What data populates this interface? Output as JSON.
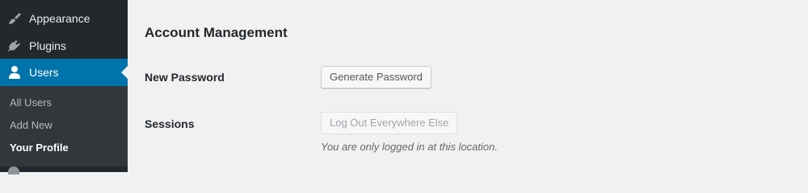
{
  "sidebar": {
    "items": [
      {
        "label": "Appearance",
        "icon": "paintbrush-icon"
      },
      {
        "label": "Plugins",
        "icon": "plugin-icon"
      },
      {
        "label": "Users",
        "icon": "user-icon",
        "active": true
      }
    ],
    "submenu": [
      {
        "label": "All Users"
      },
      {
        "label": "Add New"
      },
      {
        "label": "Your Profile",
        "current": true
      }
    ]
  },
  "account": {
    "title": "Account Management",
    "new_password_label": "New Password",
    "generate_password_button": "Generate Password",
    "sessions_label": "Sessions",
    "logout_everywhere_button": "Log Out Everywhere Else",
    "sessions_description": "You are only logged in at this location."
  },
  "colors": {
    "sidebar_bg": "#23282d",
    "submenu_bg": "#32373c",
    "active_bg": "#0073aa",
    "content_bg": "#f1f1f1"
  }
}
